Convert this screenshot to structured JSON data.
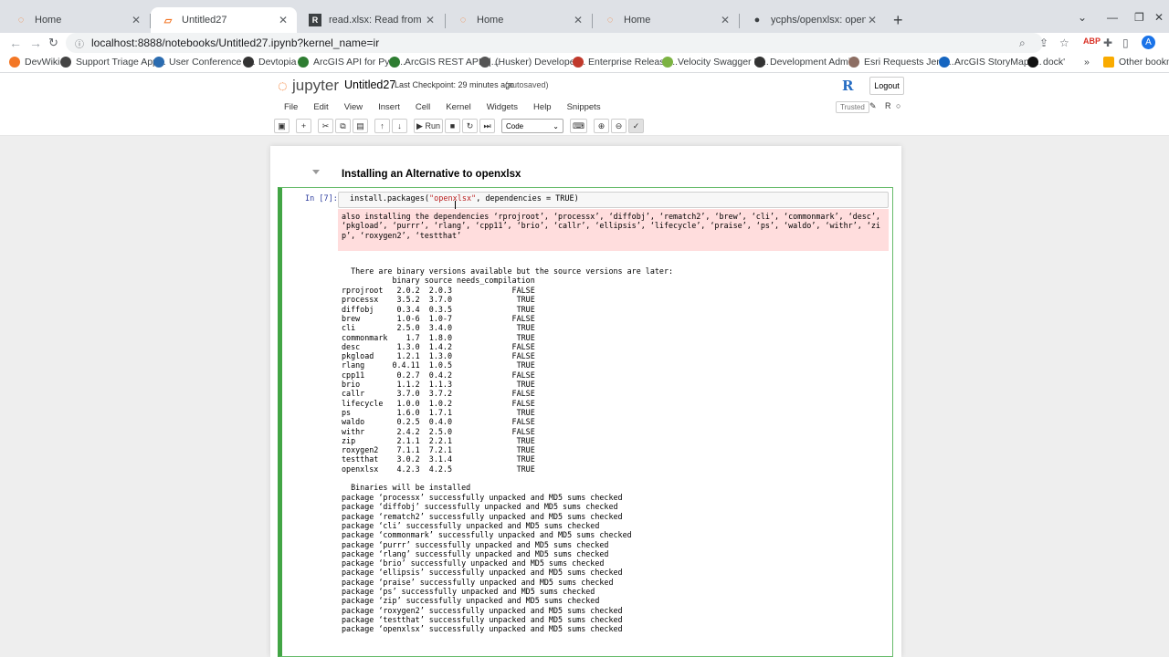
{
  "tabs": [
    {
      "label": "Home",
      "icon": "jupyter-icon"
    },
    {
      "label": "Untitled27",
      "icon": "notebook-icon"
    },
    {
      "label": "read.xlsx: Read from an Excel file",
      "icon": "r-icon"
    },
    {
      "label": "Home",
      "icon": "jupyter-icon"
    },
    {
      "label": "Home",
      "icon": "jupyter-icon"
    },
    {
      "label": "ycphs/openxlsx: openxlsx - a fast",
      "icon": "github-icon"
    }
  ],
  "url": "localhost:8888/notebooks/Untitled27.ipynb?kernel_name=ir",
  "bookmarks": [
    "DevWiki",
    "Support Triage App...",
    "User Conference -...",
    "Devtopia",
    "ArcGIS API for Pyth...",
    "ArcGIS REST APIs |...",
    "(Husker) Developer...",
    "Enterprise Release...",
    "Velocity Swagger D...",
    "Development Admi...",
    "Esri Requests Jenki...",
    "ArcGIS StoryMaps...",
    "dock'",
    "Other bookmarks"
  ],
  "avatar": "A",
  "jupyter": {
    "logo": "jupyter",
    "notebook_name": "Untitled27",
    "checkpoint": "Last Checkpoint: 29 minutes ago",
    "autosave": "(autosaved)",
    "logout": "Logout",
    "trusted": "Trusted",
    "kernel_indicator": "R",
    "menu": [
      "File",
      "Edit",
      "View",
      "Insert",
      "Cell",
      "Kernel",
      "Widgets",
      "Help",
      "Snippets"
    ],
    "run_label": "Run",
    "cell_type": "Code"
  },
  "cell": {
    "heading": "Installing an Alternative to openxlsx",
    "prompt": "In [7]:",
    "code_prefix": "install.packages(",
    "code_string": "\"openxlsx\"",
    "code_suffix": ", dependencies = TRUE)",
    "stderr": "also installing the dependencies ‘rprojroot’, ‘processx’, ‘diffobj’, ‘rematch2’, ‘brew’, ‘cli’, ‘commonmark’, ‘desc’, ‘pkgload’, ‘purrr’, ‘rlang’, ‘cpp11’, ‘brio’, ‘callr’, ‘ellipsis’, ‘lifecycle’, ‘praise’, ‘ps’, ‘waldo’, ‘withr’, ‘zip’, ‘roxygen2’, ‘testthat’",
    "binary_header": "  There are binary versions available but the source versions are later:",
    "table_header": "           binary source needs_compilation",
    "table_rows": [
      "rprojroot   2.0.2  2.0.3             FALSE",
      "processx    3.5.2  3.7.0              TRUE",
      "diffobj     0.3.4  0.3.5              TRUE",
      "brew        1.0-6  1.0-7             FALSE",
      "cli         2.5.0  3.4.0              TRUE",
      "commonmark    1.7  1.8.0              TRUE",
      "desc        1.3.0  1.4.2             FALSE",
      "pkgload     1.2.1  1.3.0             FALSE",
      "rlang      0.4.11  1.0.5              TRUE",
      "cpp11       0.2.7  0.4.2             FALSE",
      "brio        1.1.2  1.1.3              TRUE",
      "callr       3.7.0  3.7.2             FALSE",
      "lifecycle   1.0.0  1.0.2             FALSE",
      "ps          1.6.0  1.7.1              TRUE",
      "waldo       0.2.5  0.4.0             FALSE",
      "withr       2.4.2  2.5.0             FALSE",
      "zip         2.1.1  2.2.1              TRUE",
      "roxygen2    7.1.1  7.2.1              TRUE",
      "testthat    3.0.2  3.1.4              TRUE",
      "openxlsx    4.2.3  4.2.5              TRUE"
    ],
    "binaries_line": "  Binaries will be installed",
    "package_lines": [
      "package ‘processx’ successfully unpacked and MD5 sums checked",
      "package ‘diffobj’ successfully unpacked and MD5 sums checked",
      "package ‘rematch2’ successfully unpacked and MD5 sums checked",
      "package ‘cli’ successfully unpacked and MD5 sums checked",
      "package ‘commonmark’ successfully unpacked and MD5 sums checked",
      "package ‘purrr’ successfully unpacked and MD5 sums checked",
      "package ‘rlang’ successfully unpacked and MD5 sums checked",
      "package ‘brio’ successfully unpacked and MD5 sums checked",
      "package ‘ellipsis’ successfully unpacked and MD5 sums checked",
      "package ‘praise’ successfully unpacked and MD5 sums checked",
      "package ‘ps’ successfully unpacked and MD5 sums checked",
      "package ‘zip’ successfully unpacked and MD5 sums checked",
      "package ‘roxygen2’ successfully unpacked and MD5 sums checked",
      "package ‘testthat’ successfully unpacked and MD5 sums checked",
      "package ‘openxlsx’ successfully unpacked and MD5 sums checked"
    ]
  }
}
